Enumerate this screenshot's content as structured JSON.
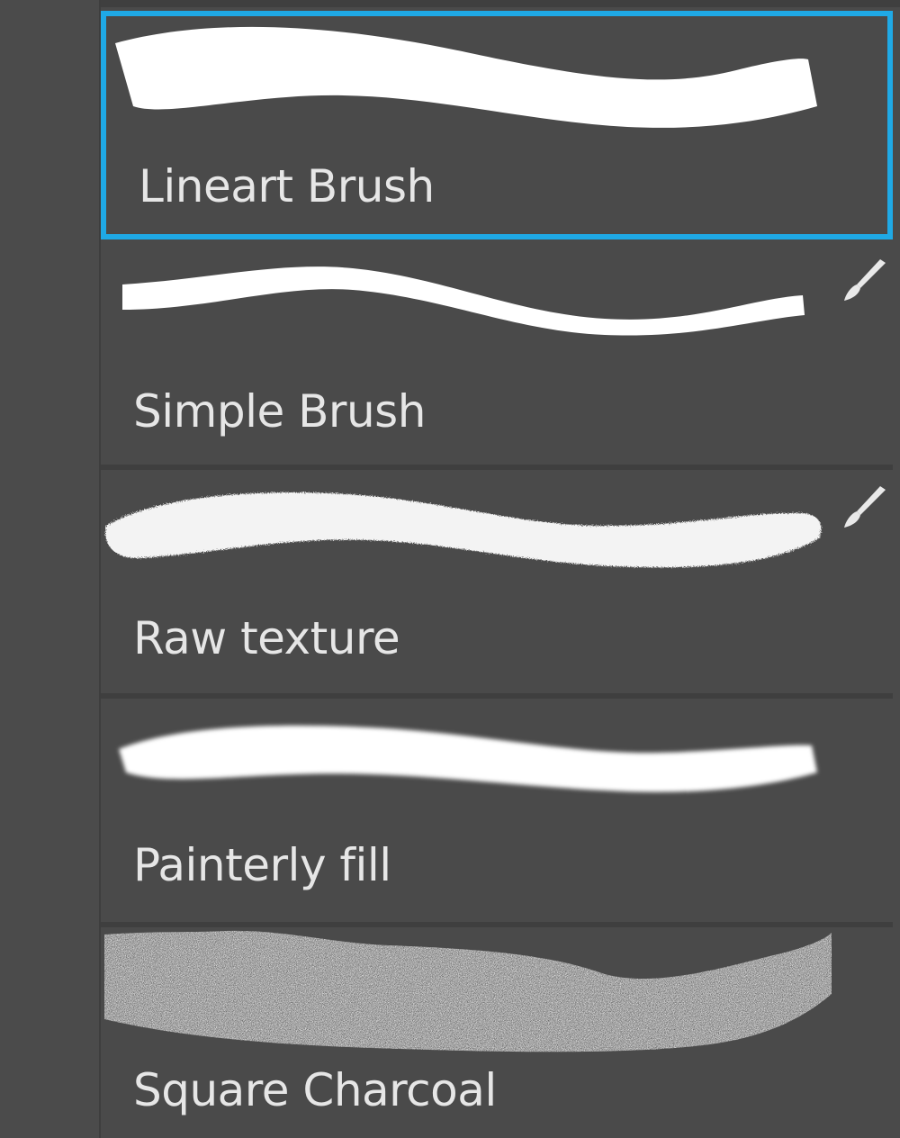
{
  "brush_list": {
    "items": [
      {
        "label": "Lineart Brush",
        "selected": true,
        "has_brush_icon": false
      },
      {
        "label": "Simple Brush",
        "selected": false,
        "has_brush_icon": true
      },
      {
        "label": "Raw texture",
        "selected": false,
        "has_brush_icon": true
      },
      {
        "label": "Painterly fill",
        "selected": false,
        "has_brush_icon": false
      },
      {
        "label": "Square Charcoal",
        "selected": false,
        "has_brush_icon": false
      }
    ]
  },
  "icons": {
    "brush_indicator": "paintbrush-icon"
  },
  "colors": {
    "panel_bg": "#4a4a4a",
    "selection_border": "#1fa9e6",
    "label_text": "#e6e6e6",
    "stroke": "#ffffff"
  }
}
